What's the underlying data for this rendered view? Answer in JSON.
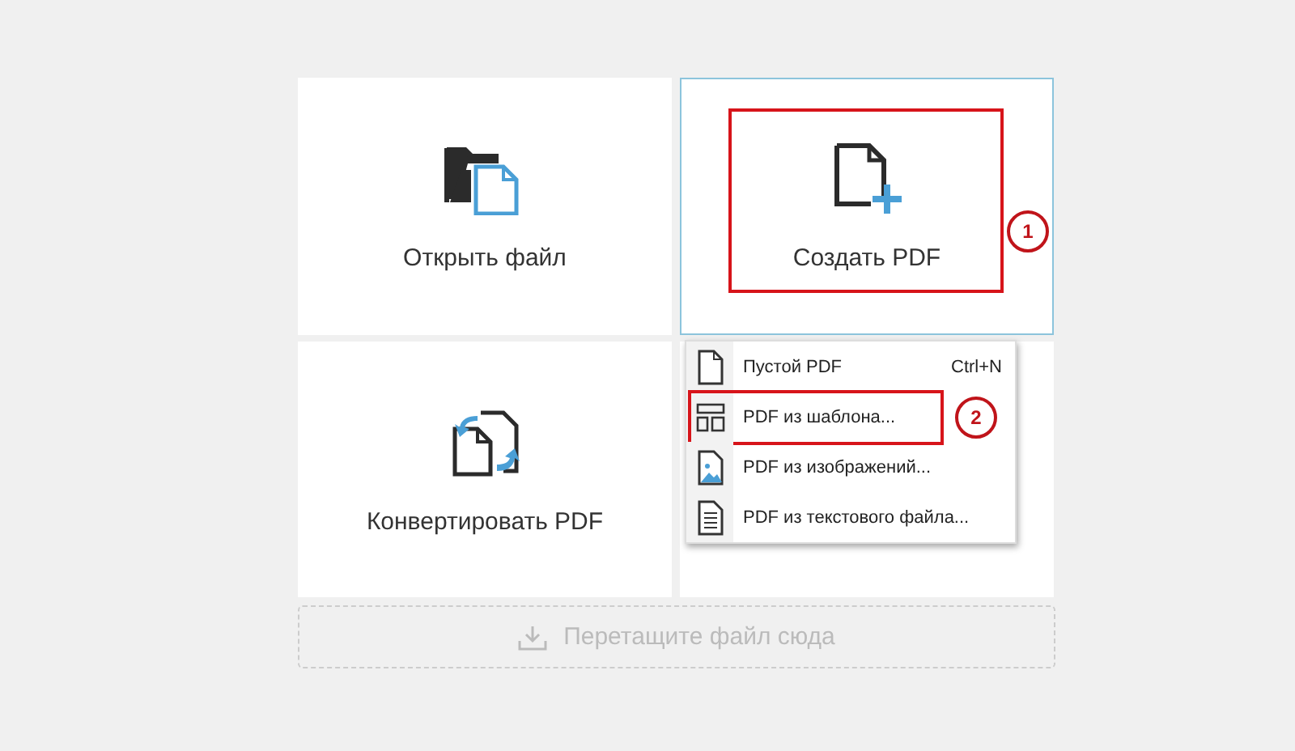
{
  "tiles": [
    {
      "kind": "open",
      "label": "Открыть файл",
      "selected": false
    },
    {
      "kind": "create",
      "label": "Создать PDF",
      "selected": true,
      "callout": "1"
    },
    {
      "kind": "convert",
      "label": "Конвертировать PDF",
      "selected": false
    }
  ],
  "menu": {
    "items": [
      {
        "kind": "blank",
        "label": "Пустой PDF",
        "shortcut": "Ctrl+N"
      },
      {
        "kind": "template",
        "label": "PDF из шаблона...",
        "callout": "2"
      },
      {
        "kind": "image",
        "label": "PDF из изображений..."
      },
      {
        "kind": "text",
        "label": "PDF из текстового файла..."
      }
    ]
  },
  "drop_zone": {
    "label": "Перетащите файл сюда"
  }
}
